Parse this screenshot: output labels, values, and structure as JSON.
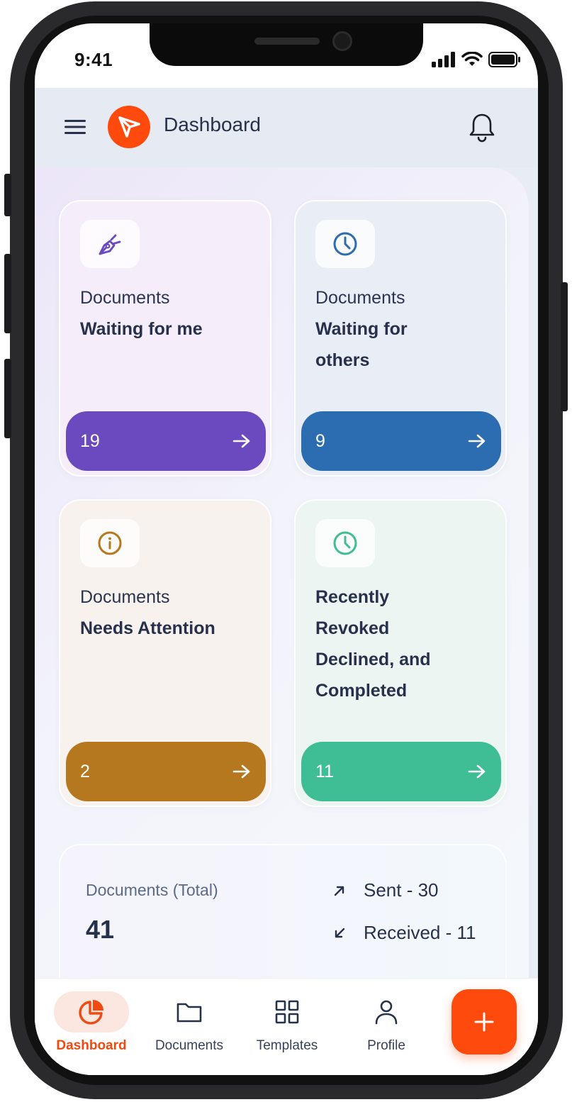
{
  "status_bar": {
    "time": "9:41"
  },
  "header": {
    "title": "Dashboard"
  },
  "cards": [
    {
      "subtitle": "Documents",
      "title_lines": [
        "Waiting for me"
      ],
      "count": "19",
      "color": "#6b49bf",
      "bg": "#f5eefa",
      "icon": "pen-nib-icon"
    },
    {
      "subtitle": "Documents",
      "title_lines": [
        "Waiting for",
        "others"
      ],
      "count": "9",
      "color": "#2c6cb0",
      "bg": "#e8edf6",
      "icon": "clock-icon"
    },
    {
      "subtitle": "Documents",
      "title_lines": [
        "Needs Attention"
      ],
      "count": "2",
      "color": "#b5781f",
      "bg": "#f8f2ee",
      "icon": "info-icon"
    },
    {
      "subtitle": "",
      "title_lines": [
        "Recently",
        "Revoked",
        "Declined, and",
        "Completed"
      ],
      "count": "11",
      "color": "#3fbe96",
      "bg": "#ecf5f1",
      "icon": "clock-icon"
    }
  ],
  "totals": {
    "label": "Documents (Total)",
    "value": "41",
    "sent": "Sent - 30",
    "received": "Received - 11"
  },
  "bottom_nav": [
    {
      "label": "Dashboard",
      "icon": "pie-chart-icon",
      "active": true
    },
    {
      "label": "Documents",
      "icon": "folder-icon",
      "active": false
    },
    {
      "label": "Templates",
      "icon": "grid-icon",
      "active": false
    },
    {
      "label": "Profile",
      "icon": "user-icon",
      "active": false
    }
  ],
  "fab": {
    "icon": "plus-icon"
  },
  "colors": {
    "accent": "#ff4a0d",
    "text_dark": "#26314a"
  }
}
